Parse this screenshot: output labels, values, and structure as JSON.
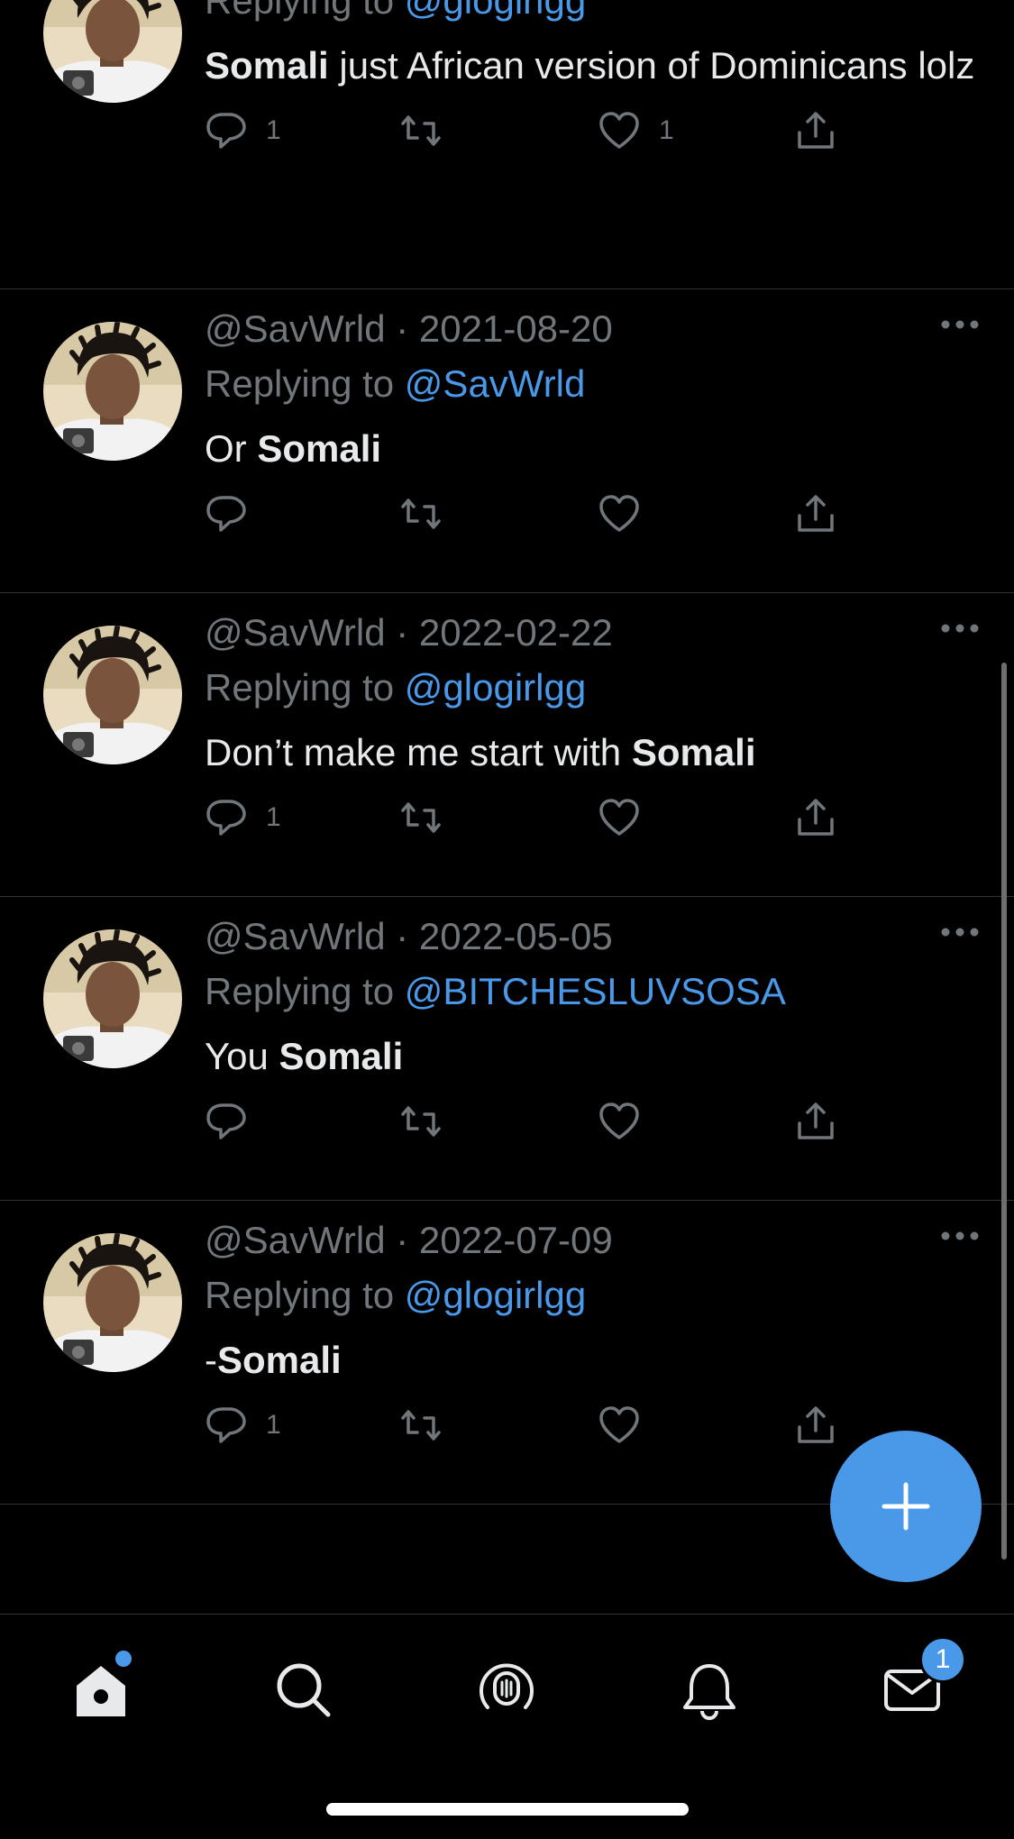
{
  "colors": {
    "accent": "#4a99e9",
    "background": "#000000",
    "muted": "#71767b",
    "text": "#e7e9ea"
  },
  "tweets": [
    {
      "handle": "",
      "date": "",
      "replying_prefix": "Replying to",
      "replying_to": "@glogirlgg",
      "segments": [
        {
          "t": "Somali",
          "b": true
        },
        {
          "t": " just African version of Dominicans lolz",
          "b": false
        }
      ],
      "replies": "1",
      "retweets": "",
      "likes": "1"
    },
    {
      "handle": "@SavWrld",
      "sep": " · ",
      "date": "2021-08-20",
      "replying_prefix": "Replying to",
      "replying_to": "@SavWrld",
      "segments": [
        {
          "t": "Or ",
          "b": false
        },
        {
          "t": "Somali",
          "b": true
        }
      ],
      "replies": "",
      "retweets": "",
      "likes": ""
    },
    {
      "handle": "@SavWrld",
      "sep": " · ",
      "date": "2022-02-22",
      "replying_prefix": "Replying to",
      "replying_to": "@glogirlgg",
      "segments": [
        {
          "t": "Don’t make me start with ",
          "b": false
        },
        {
          "t": "Somali",
          "b": true
        }
      ],
      "replies": "1",
      "retweets": "",
      "likes": ""
    },
    {
      "handle": "@SavWrld",
      "sep": " · ",
      "date": "2022-05-05",
      "replying_prefix": "Replying to",
      "replying_to": "@BITCHESLUVSOSA",
      "segments": [
        {
          "t": "You ",
          "b": false
        },
        {
          "t": "Somali",
          "b": true
        }
      ],
      "replies": "",
      "retweets": "",
      "likes": ""
    },
    {
      "handle": "@SavWrld",
      "sep": " · ",
      "date": "2022-07-09",
      "replying_prefix": "Replying to",
      "replying_to": "@glogirlgg",
      "segments": [
        {
          "t": "-",
          "b": false
        },
        {
          "t": "Somali",
          "b": true
        }
      ],
      "replies": "1",
      "retweets": "",
      "likes": ""
    }
  ],
  "fab": {
    "icon": "plus-icon"
  },
  "tabbar": {
    "items": [
      "home-icon",
      "search-icon",
      "spaces-icon",
      "notifications-icon",
      "messages-icon"
    ],
    "messages_badge": "1"
  }
}
